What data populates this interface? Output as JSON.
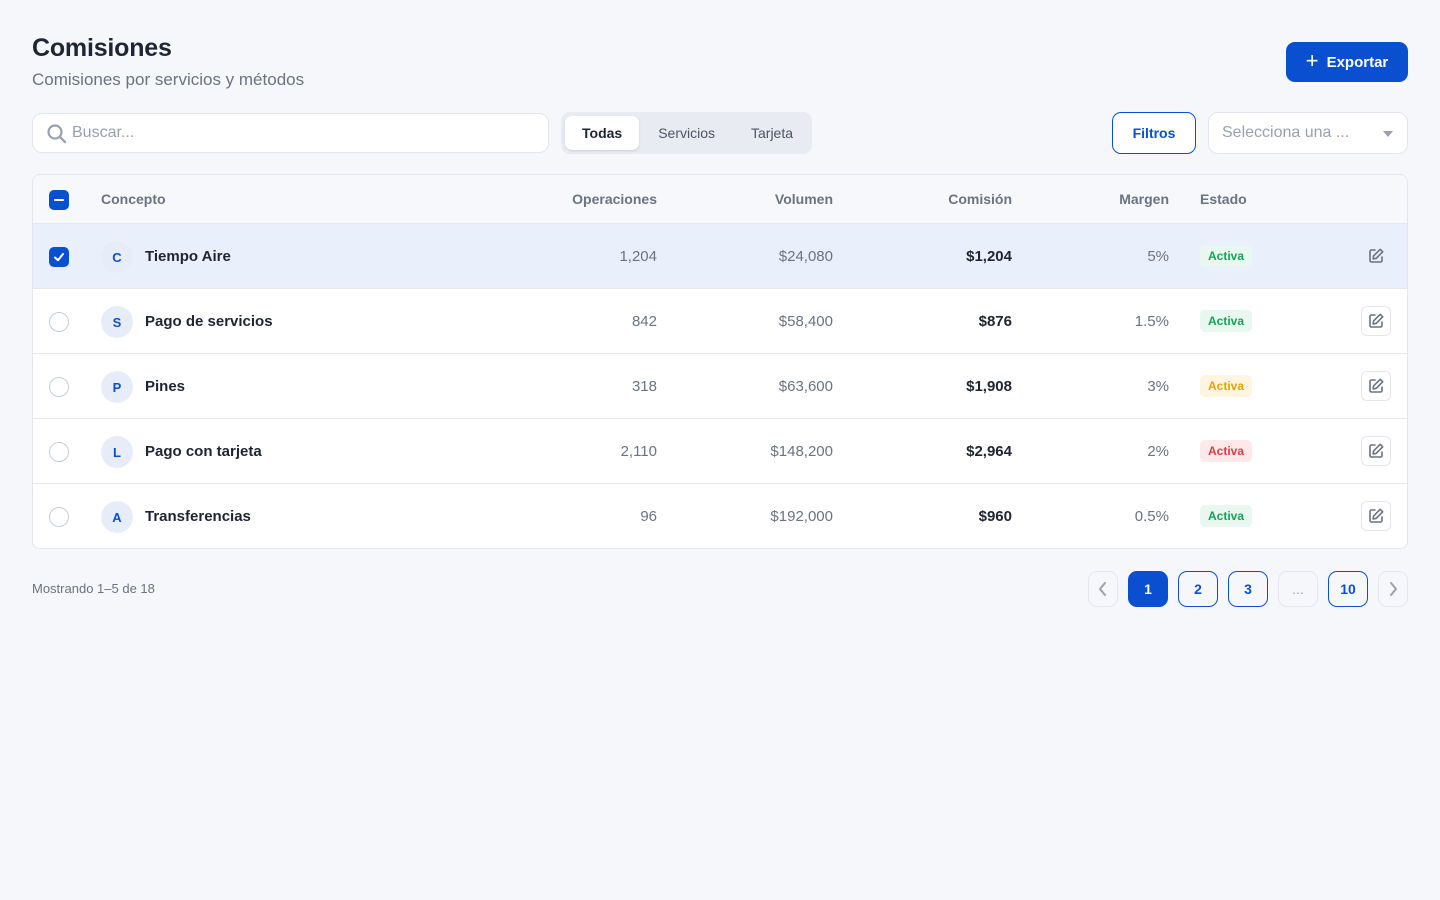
{
  "header": {
    "title": "Comisiones",
    "subtitle": "Comisiones por servicios y métodos",
    "export_label": "Exportar"
  },
  "toolbar": {
    "search_placeholder": "Buscar...",
    "segments": [
      "Todas",
      "Servicios",
      "Tarjeta"
    ],
    "active_segment": "Todas",
    "filters_label": "Filtros",
    "select_placeholder": "Selecciona una ..."
  },
  "table": {
    "columns": {
      "concept": "Concepto",
      "operations": "Operaciones",
      "volume": "Volumen",
      "commission": "Comisión",
      "margin": "Margen",
      "status": "Estado"
    },
    "rows": [
      {
        "initial": "C",
        "concept": "Tiempo Aire",
        "operations": "1,204",
        "volume": "$24,080",
        "commission": "$1,204",
        "margin": "5%",
        "status": "Activa",
        "status_color": "green",
        "selected": true
      },
      {
        "initial": "S",
        "concept": "Pago de servicios",
        "operations": "842",
        "volume": "$58,400",
        "commission": "$876",
        "margin": "1.5%",
        "status": "Activa",
        "status_color": "green",
        "selected": false
      },
      {
        "initial": "P",
        "concept": "Pines",
        "operations": "318",
        "volume": "$63,600",
        "commission": "$1,908",
        "margin": "3%",
        "status": "Activa",
        "status_color": "yellow",
        "selected": false
      },
      {
        "initial": "L",
        "concept": "Pago con tarjeta",
        "operations": "2,110",
        "volume": "$148,200",
        "commission": "$2,964",
        "margin": "2%",
        "status": "Activa",
        "status_color": "red",
        "selected": false
      },
      {
        "initial": "A",
        "concept": "Transferencias",
        "operations": "96",
        "volume": "$192,000",
        "commission": "$960",
        "margin": "0.5%",
        "status": "Activa",
        "status_color": "green",
        "selected": false
      }
    ]
  },
  "footer": {
    "showing": "Mostrando 1–5 de 18",
    "pages": [
      "1",
      "2",
      "3",
      "...",
      "10"
    ],
    "current_page": "1"
  },
  "colors": {
    "primary": "#0a4fcf",
    "background": "#f5f7fb",
    "selected_row": "#eaf0fb"
  }
}
